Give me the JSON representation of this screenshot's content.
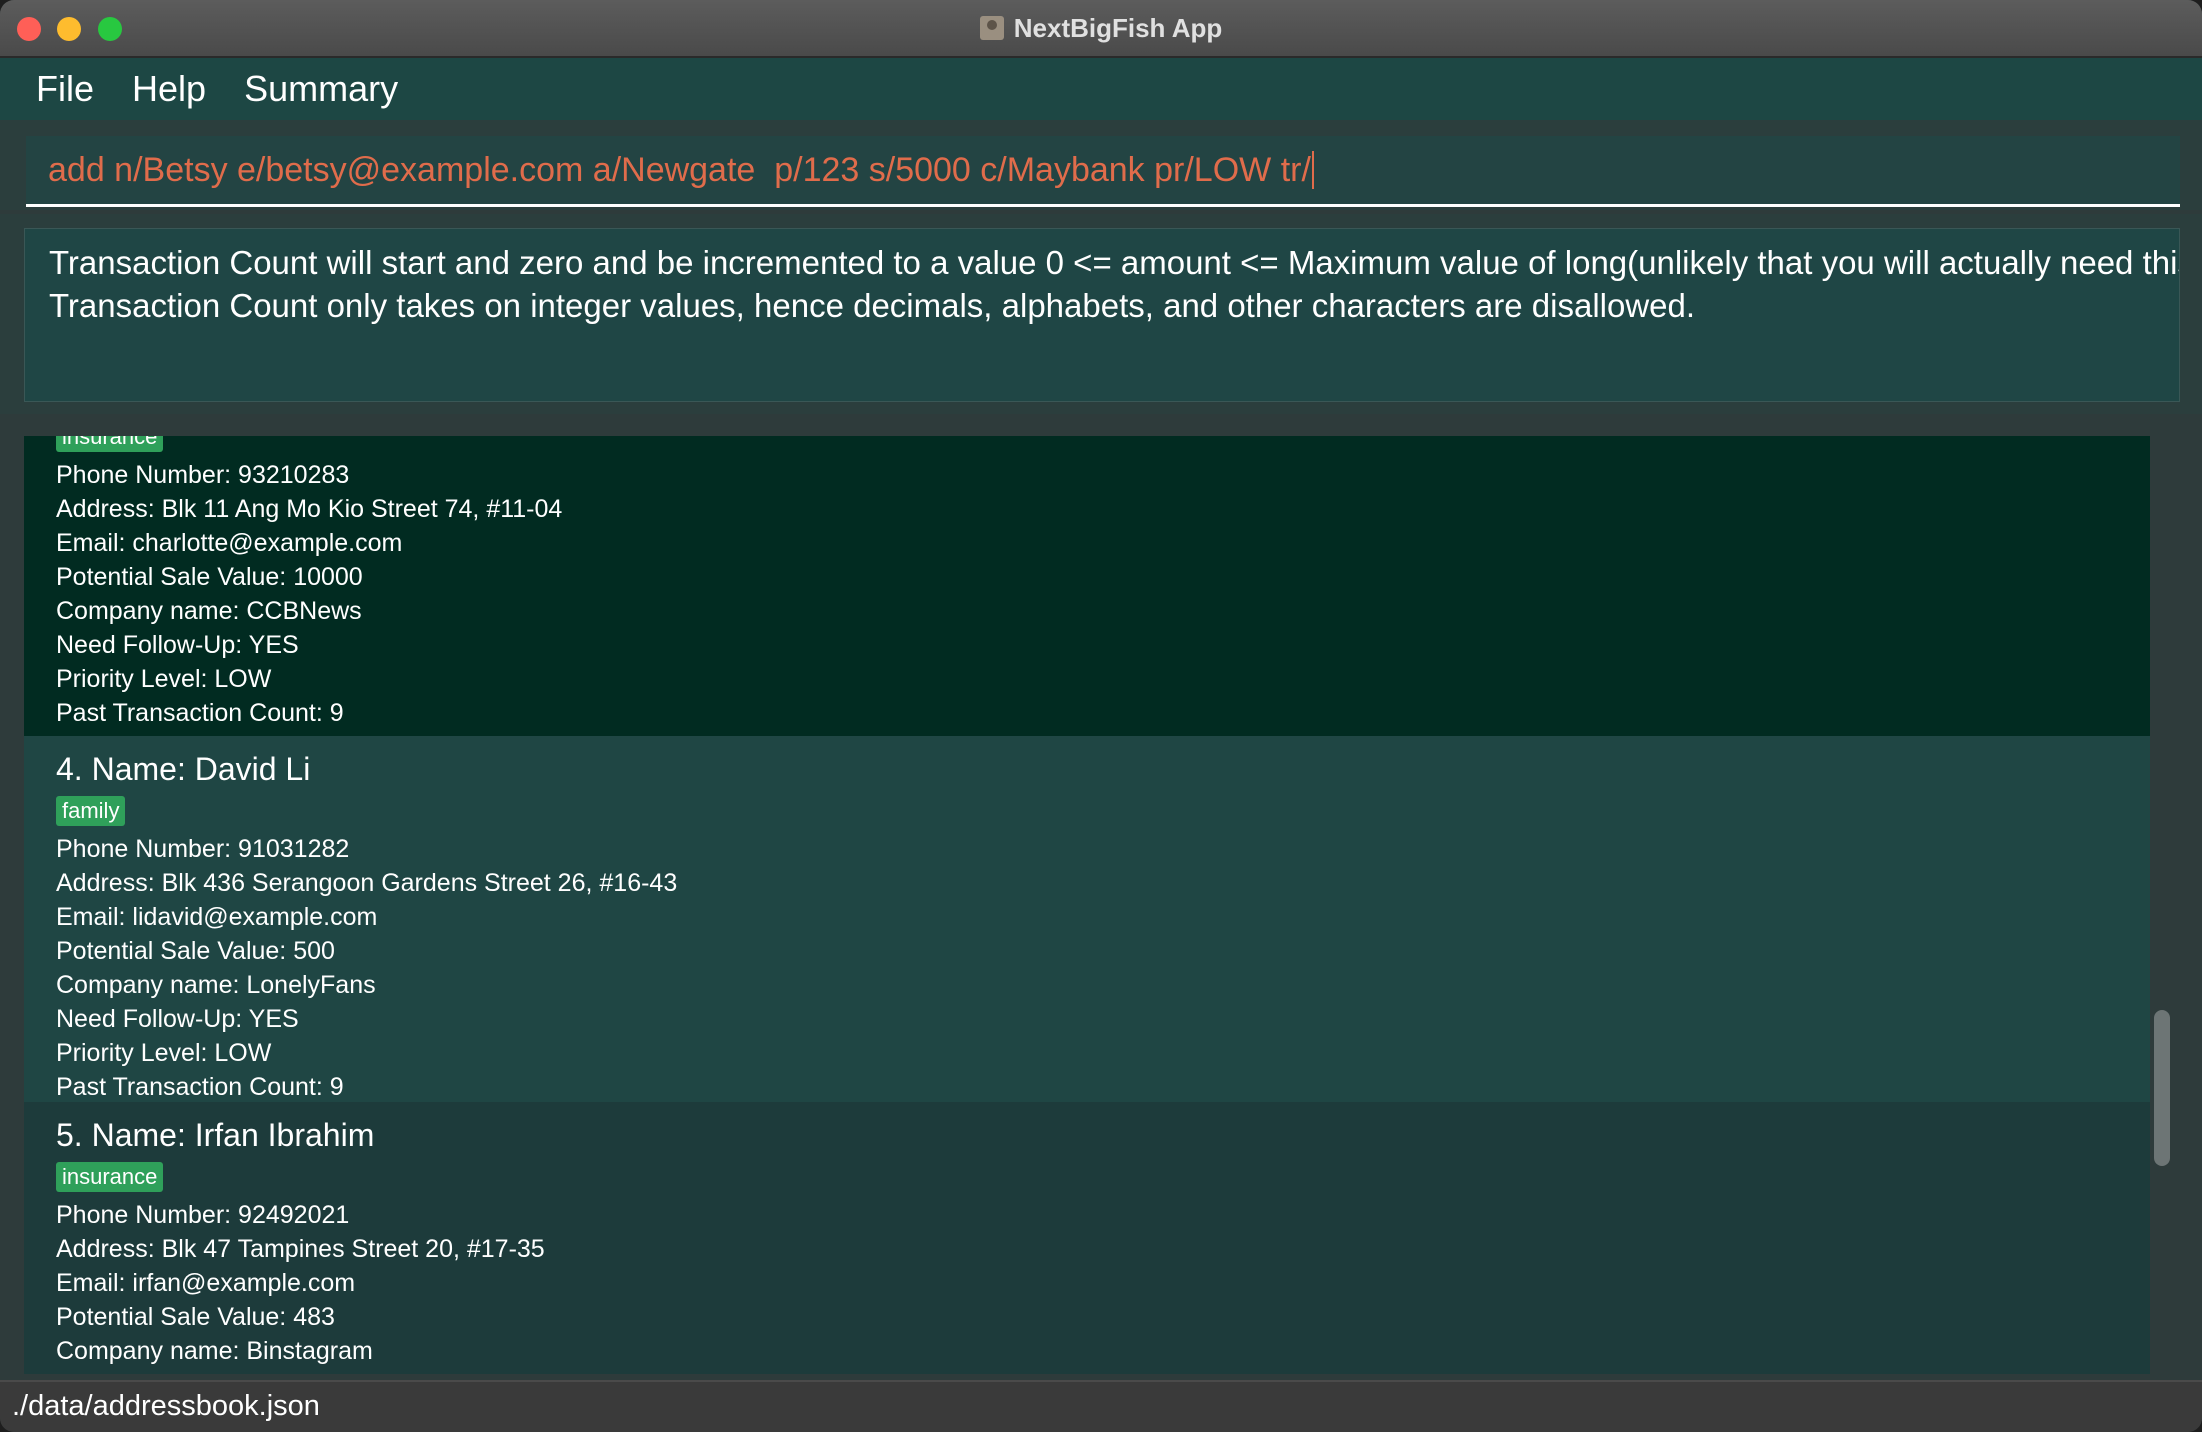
{
  "window": {
    "title": "NextBigFish App"
  },
  "menu": {
    "items": [
      "File",
      "Help",
      "Summary"
    ]
  },
  "command": {
    "value": "add n/Betsy e/betsy@example.com a/Newgate  p/123 s/5000 c/Maybank pr/LOW tr/"
  },
  "result": {
    "lines": [
      "Transaction Count will start and zero and be incremented to a value 0 <= amount <= Maximum value of long(unlikely that you will actually need this",
      "Transaction Count only takes on integer values, hence decimals, alphabets, and other characters are disallowed."
    ]
  },
  "persons": [
    {
      "tag": "insurance",
      "fields": [
        "Phone Number: 93210283",
        "Address: Blk 11 Ang Mo Kio Street 74, #11-04",
        "Email: charlotte@example.com",
        "Potential Sale Value: 10000",
        "Company name: CCBNews",
        "Need Follow-Up: YES",
        "Priority Level: LOW",
        "Past Transaction Count: 9"
      ]
    },
    {
      "header": "4.  Name: David Li",
      "tag": "family",
      "fields": [
        "Phone Number: 91031282",
        "Address: Blk 436 Serangoon Gardens Street 26, #16-43",
        "Email: lidavid@example.com",
        "Potential Sale Value: 500",
        "Company name: LonelyFans",
        "Need Follow-Up: YES",
        "Priority Level: LOW",
        "Past Transaction Count: 9"
      ]
    },
    {
      "header": "5.  Name: Irfan Ibrahim",
      "tag": "insurance",
      "fields": [
        "Phone Number: 92492021",
        "Address: Blk 47 Tampines Street 20, #17-35",
        "Email: irfan@example.com",
        "Potential Sale Value: 483",
        "Company name: Binstagram"
      ]
    }
  ],
  "status": {
    "path": "./data/addressbook.json"
  },
  "colors": {
    "menubar": "#1d4744",
    "command_text": "#e06c4b",
    "selected_card": "#012b21",
    "tag": "#2fa05a"
  }
}
